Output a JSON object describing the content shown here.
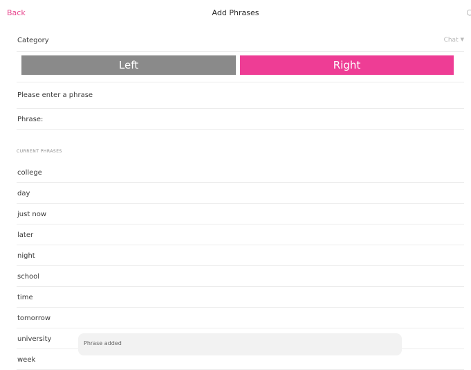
{
  "nav": {
    "back_label": "Back",
    "title": "Add Phrases",
    "right_glyph": "○"
  },
  "category": {
    "label": "Category",
    "value": "Chat",
    "caret": "▼"
  },
  "segments": {
    "left_label": "Left",
    "right_label": "Right",
    "selected": "Right"
  },
  "prompt": "Please enter a phrase",
  "phrase_field": {
    "label": "Phrase:",
    "value": ""
  },
  "current_phrases": {
    "header": "CURRENT PHRASES",
    "items": [
      "college",
      "day",
      "just now",
      "later",
      "night",
      "school",
      "time",
      "tomorrow",
      "university",
      "week"
    ]
  },
  "toast": {
    "message": "Phrase added"
  },
  "colors": {
    "accent": "#ee3d95",
    "back_link": "#e8488f",
    "segment_unselected": "#8a8a8a",
    "toast_bg": "#f2f2f2"
  }
}
